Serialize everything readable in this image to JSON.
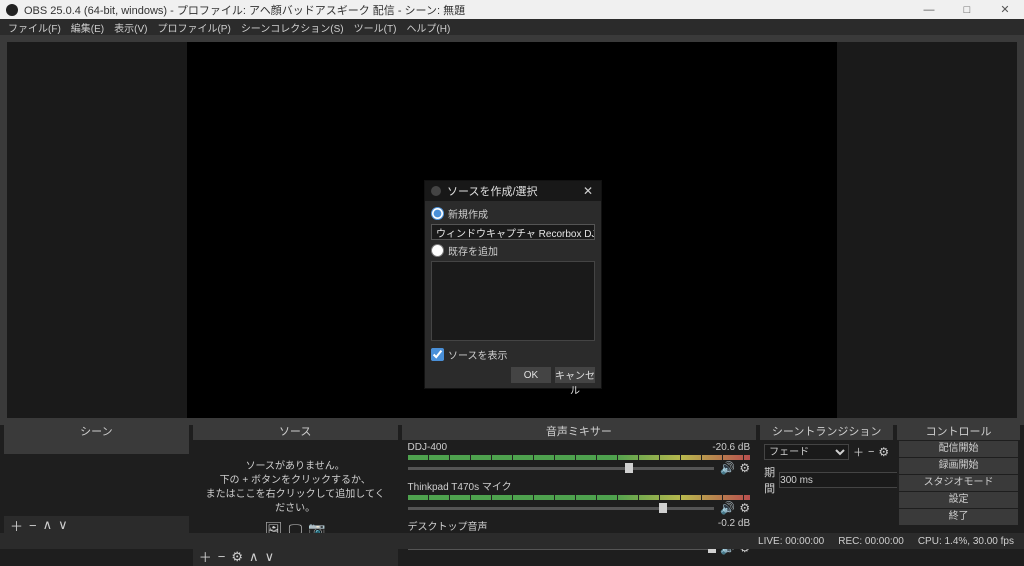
{
  "window_title": "OBS 25.0.4 (64-bit, windows) - プロファイル: アヘ顔バッドアスギーク 配信 - シーン: 無題",
  "menubar": [
    "ファイル(F)",
    "編集(E)",
    "表示(V)",
    "プロファイル(P)",
    "シーンコレクション(S)",
    "ツール(T)",
    "ヘルプ(H)"
  ],
  "docks": {
    "scenes": {
      "title": "シーン",
      "items": [
        ""
      ]
    },
    "sources": {
      "title": "ソース",
      "empty_line1": "ソースがありません。",
      "empty_line2": "下の + ボタンをクリックするか、",
      "empty_line3": "またはここを右クリックして追加してください。"
    },
    "mixer": {
      "title": "音声ミキサー",
      "tracks": [
        {
          "name": "DDJ-400",
          "db": "-20.6 dB",
          "thumb_pct": 71,
          "meter_pct": 100,
          "muted": false
        },
        {
          "name": "Thinkpad T470s マイク",
          "db": "",
          "thumb_pct": 82,
          "meter_pct": 100,
          "muted": true
        },
        {
          "name": "デスクトップ音声",
          "db": "-0.2 dB",
          "thumb_pct": 98,
          "meter_pct": 100,
          "muted": false
        }
      ]
    },
    "transitions": {
      "title": "シーントランジション",
      "mode": "フェード",
      "duration_label": "期間",
      "duration": "300 ms"
    },
    "controls": {
      "title": "コントロール",
      "buttons": [
        "配信開始",
        "録画開始",
        "スタジオモード",
        "設定",
        "終了"
      ]
    }
  },
  "statusbar": {
    "live": "LIVE: 00:00:00",
    "rec": "REC: 00:00:00",
    "cpu": "CPU: 1.4%, 30.00 fps"
  },
  "dialog": {
    "title": "ソースを作成/選択",
    "opt_new": "新規作成",
    "new_name": "ウィンドウキャプチャ Recorbox DJ",
    "opt_existing": "既存を追加",
    "chk_visible": "ソースを表示",
    "ok": "OK",
    "cancel": "キャンセル"
  }
}
